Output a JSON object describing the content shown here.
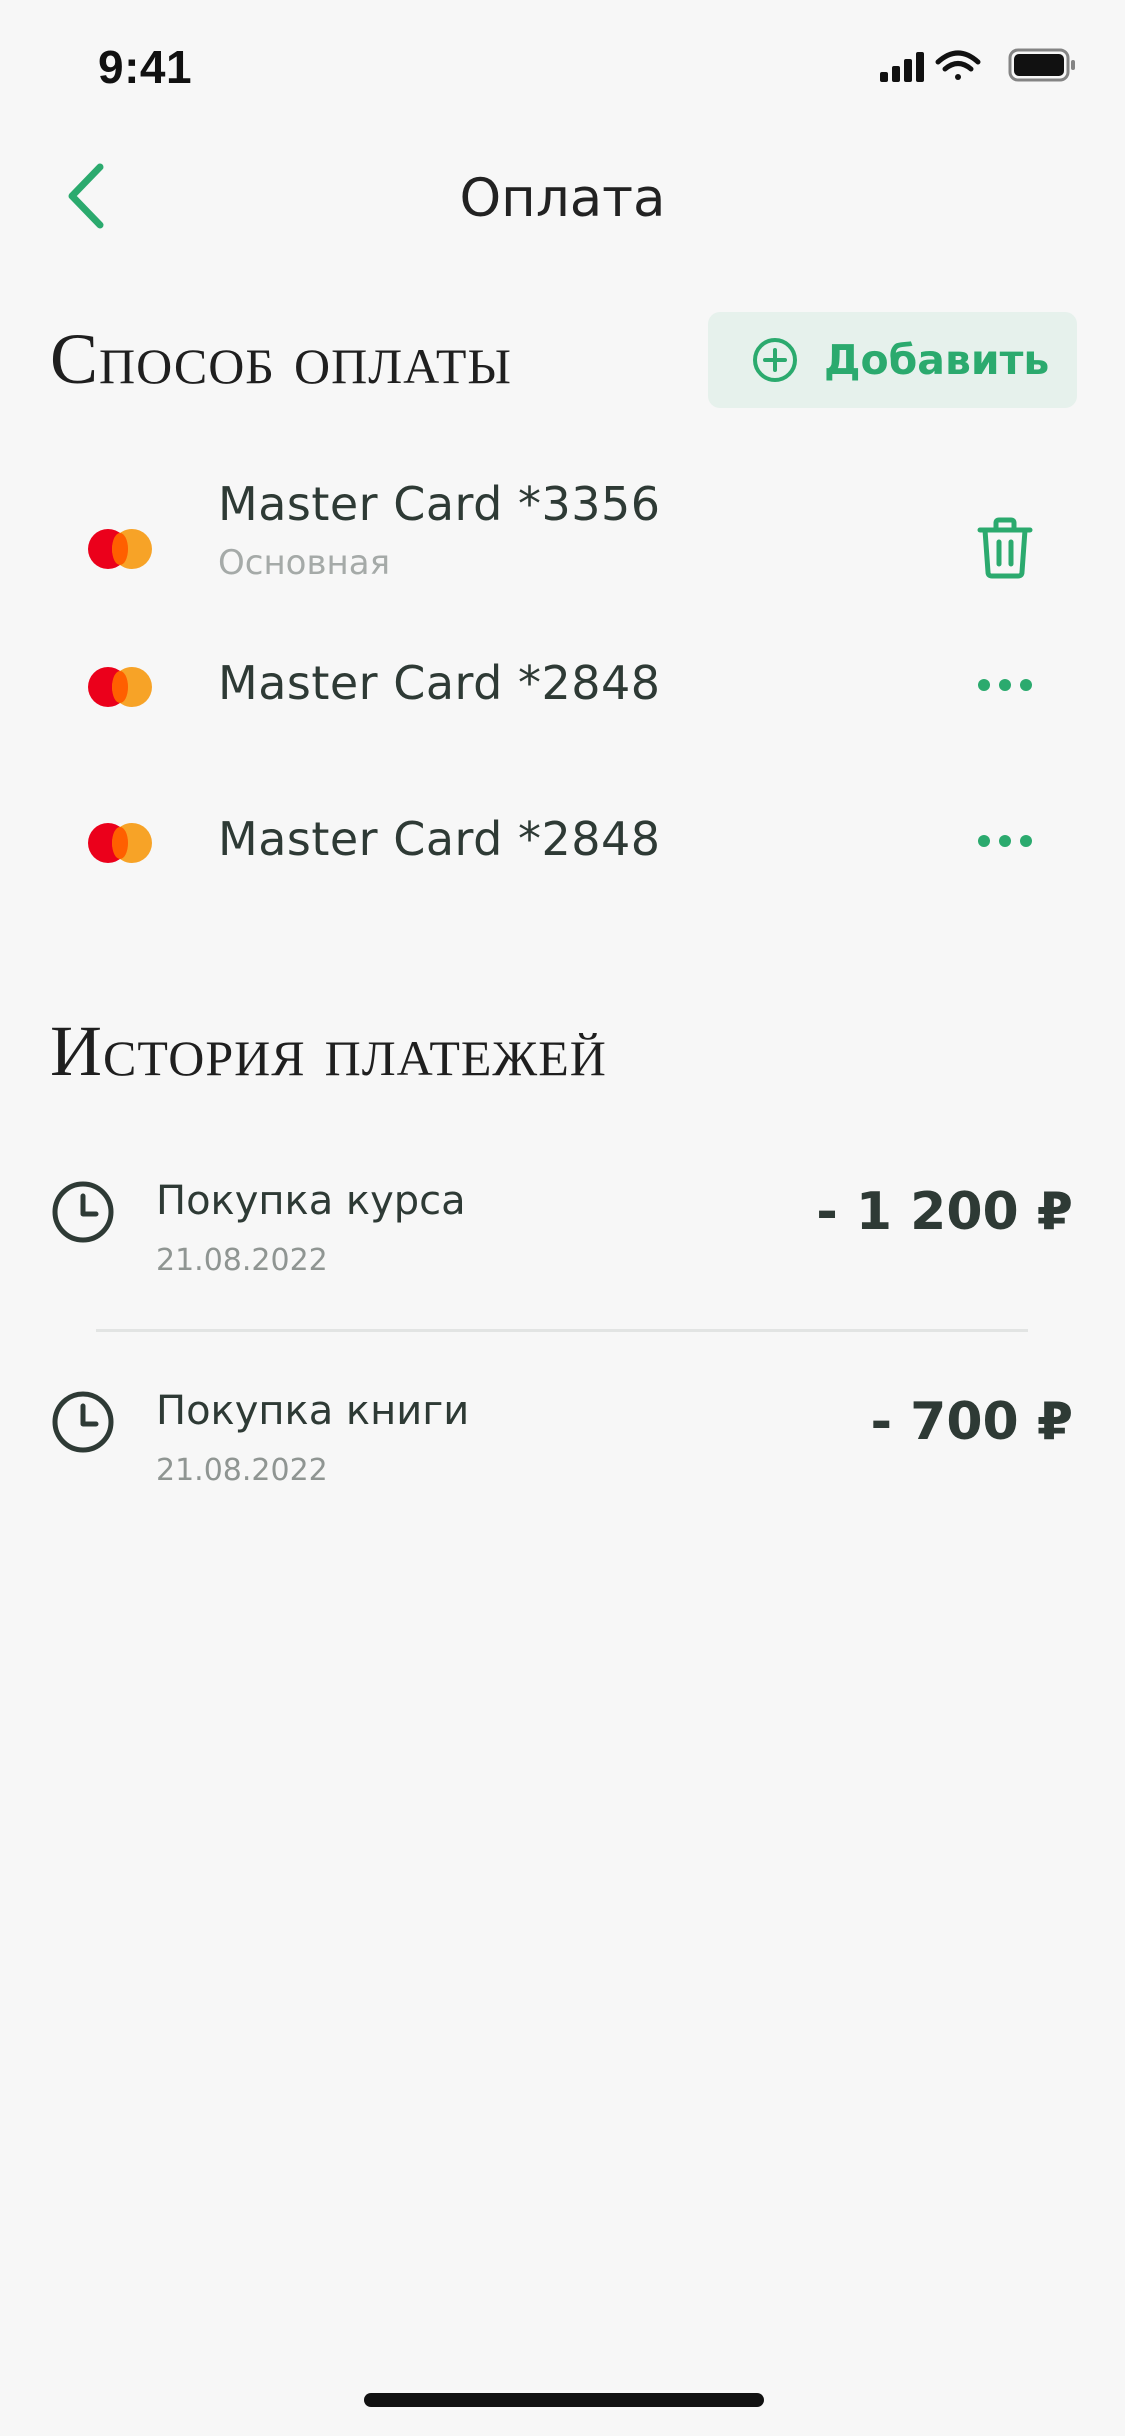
{
  "status_bar": {
    "time": "9:41"
  },
  "header": {
    "title": "Оплата"
  },
  "payment_methods": {
    "title": "Способ оплаты",
    "add_label": "Добавить",
    "cards": [
      {
        "name": "Master Card *3356",
        "subtitle": "Основная",
        "action_icon": "trash-icon"
      },
      {
        "name": "Master Card *2848",
        "subtitle": "",
        "action_icon": "more-icon"
      },
      {
        "name": "Master Card *2848",
        "subtitle": "",
        "action_icon": "more-icon"
      }
    ]
  },
  "history": {
    "title": "История платежей",
    "items": [
      {
        "title": "Покупка курса",
        "date": "21.08.2022",
        "amount": "- 1 200 ₽"
      },
      {
        "title": "Покупка книги",
        "date": "21.08.2022",
        "amount": "- 700 ₽"
      }
    ]
  },
  "colors": {
    "accent": "#2BAA6E",
    "accent_bg": "#E6F1EC",
    "text": "#2E3A35",
    "background": "#F7F7F7"
  }
}
